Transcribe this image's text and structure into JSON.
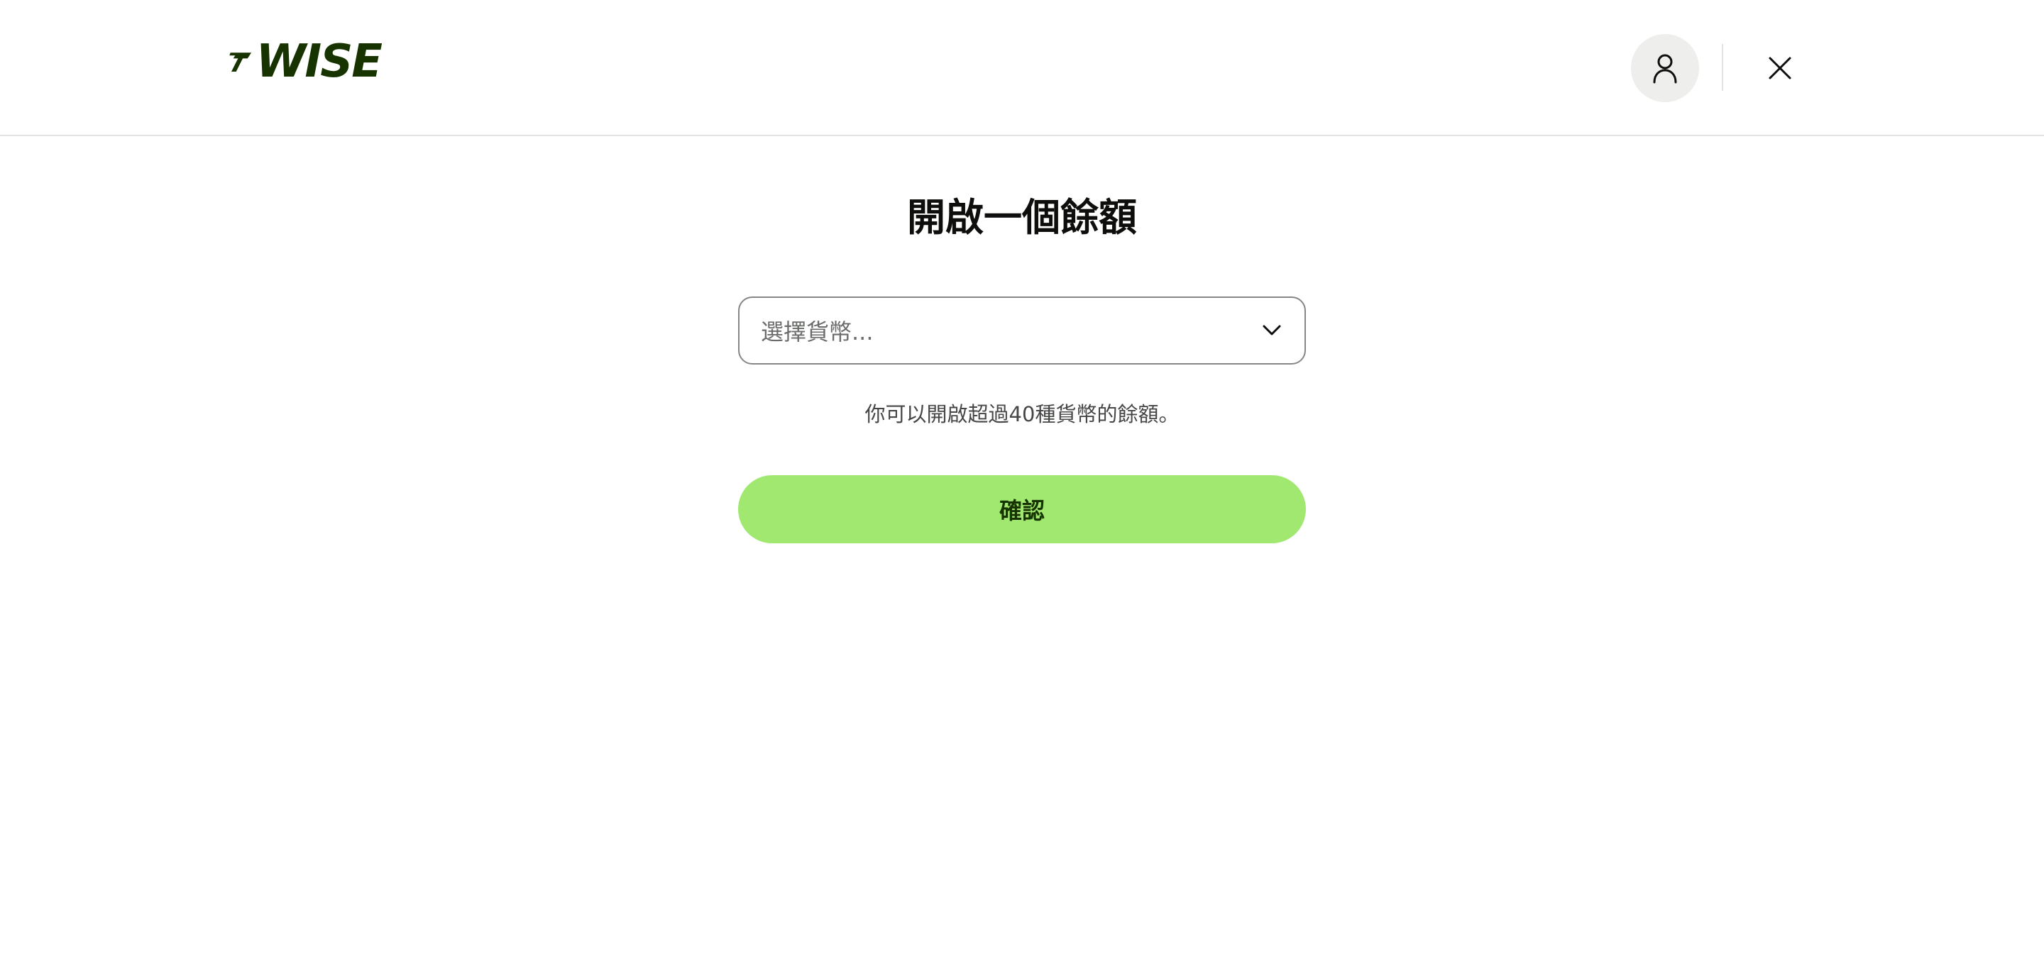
{
  "header": {
    "logo_text": "WISE",
    "profile_icon": "user-icon",
    "close_icon": "close-icon"
  },
  "main": {
    "title": "開啟一個餘額",
    "currency_select": {
      "placeholder": "選擇貨幣...",
      "icon": "chevron-down-icon"
    },
    "helper_text": "你可以開啟超過40種貨幣的餘額。",
    "confirm_label": "確認"
  },
  "colors": {
    "brand_dark_green": "#163300",
    "brand_bright_green": "#a0e870",
    "profile_bg": "#eeeeec"
  }
}
